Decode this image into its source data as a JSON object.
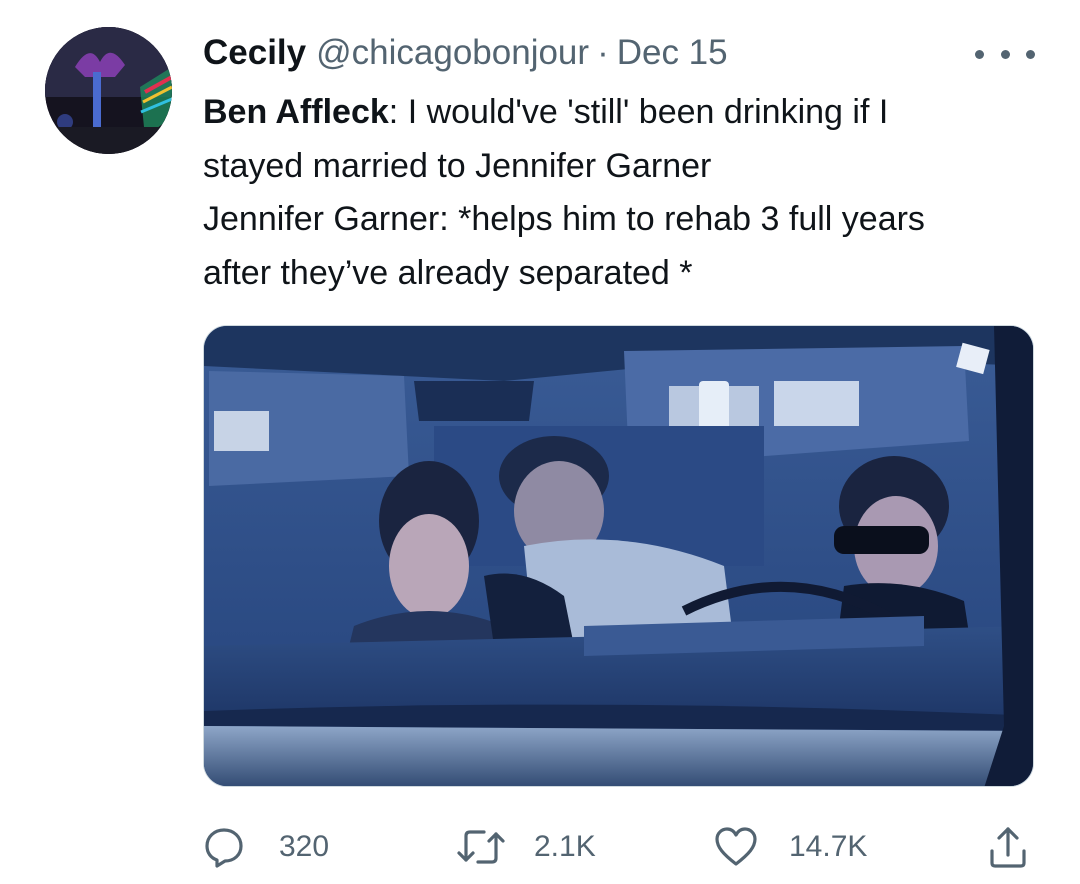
{
  "tweet": {
    "author": {
      "display_name": "Cecily",
      "handle": "@chicagobonjour",
      "avatar_icon": "avatar-photo"
    },
    "separator": "·",
    "date": "Dec 15",
    "more_icon": "more-horizontal-icon",
    "text": {
      "line1_bold": "Ben Affleck",
      "line1_rest": ": I would've 'still' been drinking if I",
      "line2": "stayed married to Jennifer Garner",
      "line3": "Jennifer Garner: *helps him to rehab 3 full years",
      "line4": "after they’ve already  separated *"
    },
    "media": {
      "type": "photo"
    },
    "actions": {
      "reply": {
        "icon": "reply-icon",
        "count": "320"
      },
      "retweet": {
        "icon": "retweet-icon",
        "count": "2.1K"
      },
      "like": {
        "icon": "heart-icon",
        "count": "14.7K"
      },
      "share": {
        "icon": "share-icon"
      }
    }
  },
  "colors": {
    "text_primary": "#0f1419",
    "text_secondary": "#536471",
    "border": "#cfd9de"
  }
}
